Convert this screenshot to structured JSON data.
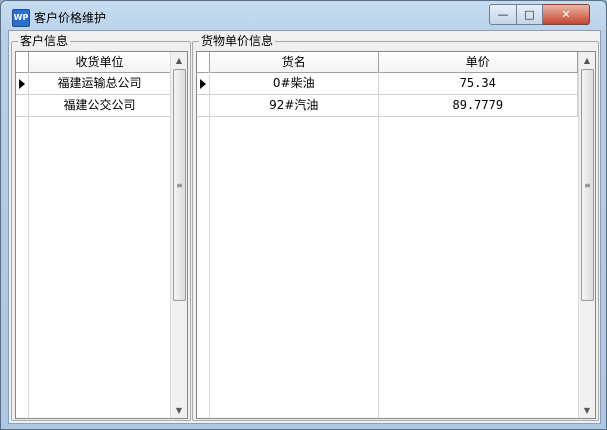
{
  "window": {
    "title": "客户价格维护",
    "icon_text": "WP",
    "controls": {
      "minimize": "—",
      "maximize": "□",
      "close": "✕"
    }
  },
  "customer_group": {
    "label": "客户信息",
    "columns": [
      "收货单位"
    ],
    "rows": [
      {
        "selected": true,
        "name": "福建运输总公司"
      },
      {
        "selected": false,
        "name": "福建公交公司"
      }
    ]
  },
  "price_group": {
    "label": "货物单价信息",
    "columns": [
      "货名",
      "单价"
    ],
    "rows": [
      {
        "selected": true,
        "item": "0#柴油",
        "price": "75.34"
      },
      {
        "selected": false,
        "item": "92#汽油",
        "price": "89.7779"
      }
    ]
  },
  "scrollbar": {
    "up": "▲",
    "down": "▼",
    "grip": "≡"
  }
}
